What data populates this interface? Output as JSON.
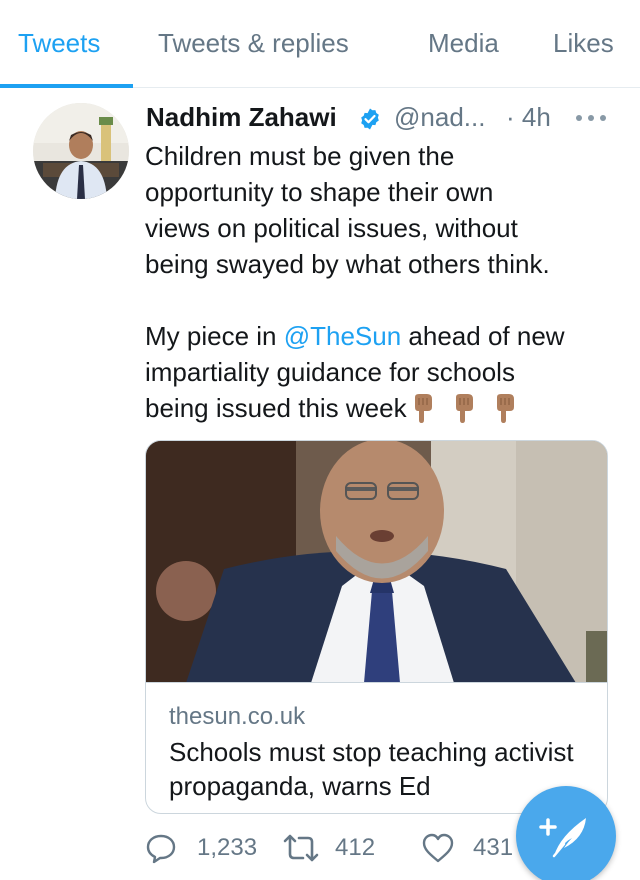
{
  "tabs": [
    {
      "label": "Tweets",
      "active": true
    },
    {
      "label": "Tweets & replies",
      "active": false
    },
    {
      "label": "Media",
      "active": false
    },
    {
      "label": "Likes",
      "active": false
    }
  ],
  "tweet": {
    "author": {
      "display_name": "Nadhim Zahawi",
      "verified": true,
      "handle": "@nad...",
      "avatar_icon": "profile-photo"
    },
    "timestamp": "· 4h",
    "text_lines": [
      "Children must be given the",
      "opportunity to shape their own",
      "views on political issues, without",
      "being swayed by what others think."
    ],
    "text2": {
      "line1_before": "My piece in ",
      "mention": "@TheSun",
      "line1_after": " ahead of new",
      "line2": "impartiality guidance for schools",
      "line3": "being issued this week",
      "emoji": "backhand-index-pointing-down x3"
    },
    "card": {
      "domain": "thesun.co.uk",
      "title": "Schools must stop teaching activist propaganda, warns Ed"
    },
    "stats": {
      "replies": "1,233",
      "retweets": "412",
      "likes": "431"
    }
  },
  "compose_button": {
    "icon": "compose-plus-feather-icon"
  },
  "colors": {
    "accent": "#1da1f2",
    "secondary_text": "#657786",
    "primary_text": "#14171a",
    "fab": "#4aa8ec",
    "divider": "#e6ecf0"
  }
}
